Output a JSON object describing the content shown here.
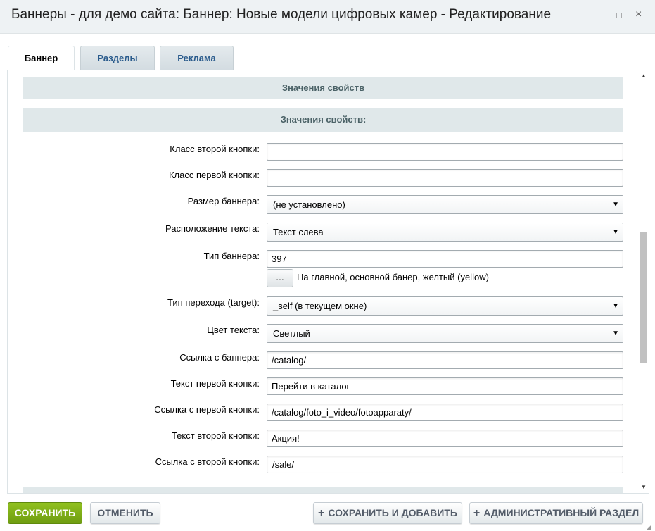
{
  "window": {
    "title": "Баннеры - для демо сайта: Баннер: Новые модели цифровых камер - Редактирование",
    "maximize_icon": "□",
    "close_icon": "×"
  },
  "tabs": [
    {
      "label": "Баннер",
      "active": true
    },
    {
      "label": "Разделы",
      "active": false
    },
    {
      "label": "Реклама",
      "active": false
    }
  ],
  "sections": {
    "properties": "Значения свойств",
    "properties_values": "Значения свойств:"
  },
  "form": {
    "second_button_class": {
      "label": "Класс второй кнопки:",
      "value": ""
    },
    "first_button_class": {
      "label": "Класс первой кнопки:",
      "value": ""
    },
    "banner_size": {
      "label": "Размер баннера:",
      "value": "(не установлено)"
    },
    "text_position": {
      "label": "Расположение текста:",
      "value": "Текст слева"
    },
    "banner_type": {
      "label": "Тип баннера:",
      "value": "397",
      "picker_label": "...",
      "description": "На главной, основной банер, желтый (yellow)"
    },
    "target": {
      "label": "Тип перехода (target):",
      "value": "_self (в текущем окне)"
    },
    "text_color": {
      "label": "Цвет текста:",
      "value": "Светлый"
    },
    "banner_link": {
      "label": "Ссылка с баннера:",
      "value": "/catalog/"
    },
    "first_button_text": {
      "label": "Текст первой кнопки:",
      "value": "Перейти в каталог"
    },
    "first_button_link": {
      "label": "Ссылка с первой кнопки:",
      "value": "/catalog/foto_i_video/fotoapparaty/"
    },
    "second_button_text": {
      "label": "Текст второй кнопки:",
      "value": "Акция!"
    },
    "second_button_link": {
      "label": "Ссылка с второй кнопки:",
      "value": "/sale/"
    }
  },
  "dropdown_arrow": "▼",
  "buttons": {
    "save": "СОХРАНИТЬ",
    "cancel": "ОТМЕНИТЬ",
    "save_and_add": "СОХРАНИТЬ И ДОБАВИТЬ",
    "admin_section": "АДМИНИСТРАТИВНЫЙ РАЗДЕЛ",
    "plus_icon": "+"
  },
  "scrollbar": {
    "up_icon": "▲",
    "down_icon": "▼"
  },
  "colors": {
    "save_button": "#7aab16",
    "tab_text": "#2a5b8c",
    "section_background": "#e0e8ea"
  }
}
